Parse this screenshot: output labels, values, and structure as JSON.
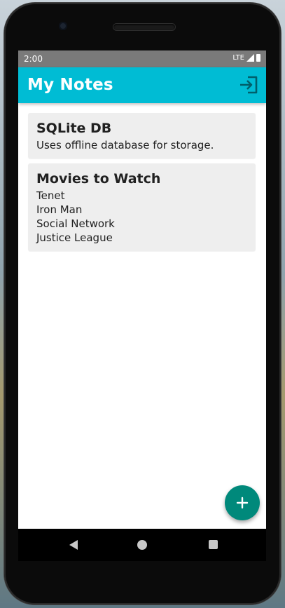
{
  "status_bar": {
    "time": "2:00",
    "network": "LTE",
    "signal_icon": "signal-icon",
    "battery_icon": "battery-icon"
  },
  "app_bar": {
    "title": "My Notes",
    "action_icon": "login-icon",
    "color": "#00bcd4"
  },
  "notes": [
    {
      "title": "SQLite DB",
      "body": "Uses offline database for storage."
    },
    {
      "title": "Movies to Watch",
      "body": "Tenet\nIron Man\nSocial Network\nJustice League"
    }
  ],
  "fab": {
    "icon": "plus-icon",
    "color": "#00897b"
  },
  "nav_bar": {
    "back_icon": "back-icon",
    "home_icon": "home-icon",
    "recents_icon": "recents-icon"
  }
}
